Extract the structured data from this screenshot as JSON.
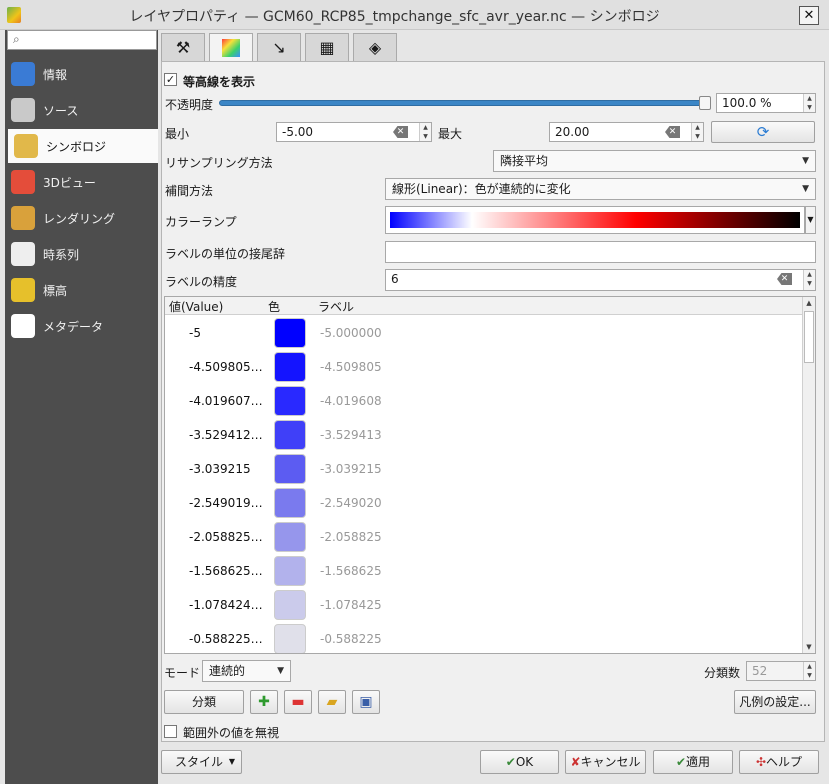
{
  "window": {
    "title": "レイヤプロパティ — GCM60_RCP85_tmpchange_sfc_avr_year.nc — シンボロジ",
    "close_label": "✕"
  },
  "sidebar": {
    "search_placeholder": "",
    "items": [
      {
        "label": "情報",
        "icon": "info-icon",
        "color": "#3a7bd5"
      },
      {
        "label": "ソース",
        "icon": "settings-icon",
        "color": "#c9c9c9"
      },
      {
        "label": "シンボロジ",
        "icon": "symbology-brush-icon",
        "color": "#e1b84a"
      },
      {
        "label": "3Dビュー",
        "icon": "cube-3d-icon",
        "color": "#e44d3a"
      },
      {
        "label": "レンダリング",
        "icon": "rendering-brush-icon",
        "color": "#d9a13b"
      },
      {
        "label": "時系列",
        "icon": "clock-icon",
        "color": "#eeeeee"
      },
      {
        "label": "標高",
        "icon": "elevation-icon",
        "color": "#e6c02b"
      },
      {
        "label": "メタデータ",
        "icon": "metadata-icon",
        "color": "#ffffff"
      }
    ],
    "active_index": 2
  },
  "tabs": [
    {
      "icon": "hammer-icon",
      "glyph": "⚒"
    },
    {
      "icon": "color-gradient-icon",
      "glyph": ""
    },
    {
      "icon": "arrow-down-right-icon",
      "glyph": "↘"
    },
    {
      "icon": "grid-table-icon",
      "glyph": "▦"
    },
    {
      "icon": "layers-stack-icon",
      "glyph": "◈"
    }
  ],
  "symbology": {
    "show_contours_label": "等高線を表示",
    "show_contours_checked": "✓",
    "opacity_label": "不透明度",
    "opacity_value": "100.0 %",
    "opacity_level": 1.0,
    "min_label": "最小",
    "min_value": "-5.00",
    "max_label": "最大",
    "max_value": "20.00",
    "resampling_label": "リサンプリング方法",
    "resampling_value": "隣接平均",
    "interpolation_label": "補間方法",
    "interpolation_value": "線形(Linear)：色が連続的に変化",
    "color_ramp_label": "カラーランプ",
    "label_suffix_label": "ラベルの単位の接尾辞",
    "label_suffix_value": "",
    "label_precision_label": "ラベルの精度",
    "label_precision_value": "6"
  },
  "table": {
    "headers": [
      "値(Value)",
      "色",
      "ラベル"
    ],
    "rows": [
      {
        "value": "-5",
        "color": "#0000ff",
        "label": "-5.000000"
      },
      {
        "value": "-4.509805…",
        "color": "#1414ff",
        "label": "-4.509805"
      },
      {
        "value": "-4.019607…",
        "color": "#2929ff",
        "label": "-4.019608"
      },
      {
        "value": "-3.529412…",
        "color": "#4040f8",
        "label": "-3.529413"
      },
      {
        "value": "-3.039215",
        "color": "#5c5cf2",
        "label": "-3.039215"
      },
      {
        "value": "-2.549019…",
        "color": "#7a7aee",
        "label": "-2.549020"
      },
      {
        "value": "-2.058825…",
        "color": "#9696ec",
        "label": "-2.058825"
      },
      {
        "value": "-1.568625…",
        "color": "#b2b2ec",
        "label": "-1.568625"
      },
      {
        "value": "-1.078424…",
        "color": "#cbcbeb",
        "label": "-1.078425"
      },
      {
        "value": "-0.588225…",
        "color": "#e0e0ea",
        "label": "-0.588225"
      }
    ]
  },
  "mode": {
    "label": "モード",
    "value": "連続的",
    "classes_label": "分類数",
    "classes_value": "52"
  },
  "buttons": {
    "classify": "分類",
    "legend_settings": "凡例の設定...",
    "ignore_out_of_range": "範囲外の値を無視",
    "style": "スタイル",
    "ok": "OK",
    "cancel": "キャンセル",
    "apply": "適用",
    "help": "ヘルプ"
  }
}
